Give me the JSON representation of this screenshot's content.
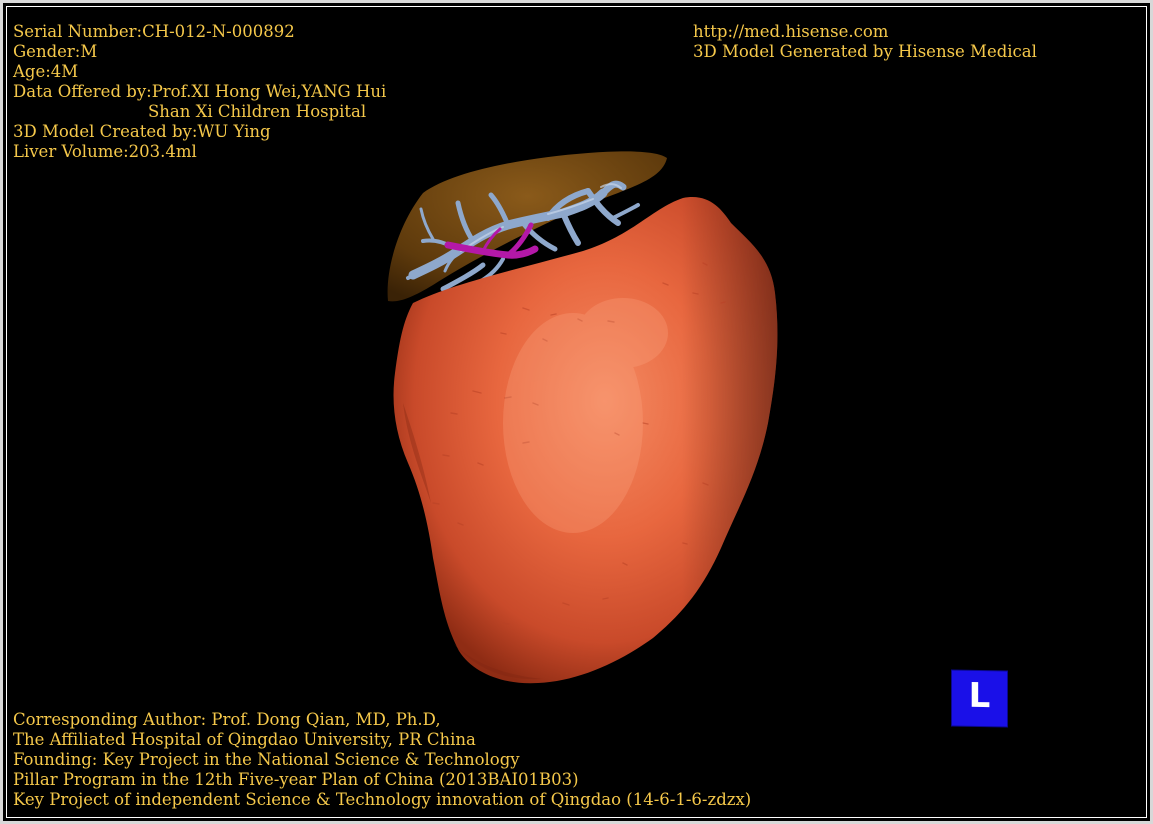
{
  "info_top_left": {
    "serial": "Serial Number:CH-012-N-000892",
    "gender": "Gender:M",
    "age": "Age:4M",
    "data_offered_line1": "Data Offered by:Prof.XI Hong Wei,YANG Hui",
    "data_offered_line2": "Shan Xi Children Hospital",
    "model_created": "3D Model Created by:WU Ying",
    "liver_volume": "Liver Volume:203.4ml"
  },
  "info_top_right": {
    "url": "http://med.hisense.com",
    "generator": "3D Model Generated by Hisense Medical"
  },
  "info_bottom_left": {
    "line1": "Corresponding Author: Prof. Dong Qian, MD, Ph.D,",
    "line2": "The Affiliated Hospital of Qingdao University, PR China",
    "line3": "Founding: Key Project in the National Science & Technology",
    "line4": "Pillar Program in the 12th Five-year Plan of China (2013BAI01B03)",
    "line5": "Key Project of independent Science & Technology innovation of Qingdao (14-6-1-6-zdzx)"
  },
  "orientation_marker": {
    "label": "L",
    "color": "#1a10e8"
  },
  "colors": {
    "background": "#000000",
    "overlay_text": "#f5c84a",
    "liver_surface": "#e2603f",
    "liver_back_lobe": "#6b4210",
    "hepatic_vessels": "#8aa4c8",
    "portal_vessels": "#b418a8"
  }
}
